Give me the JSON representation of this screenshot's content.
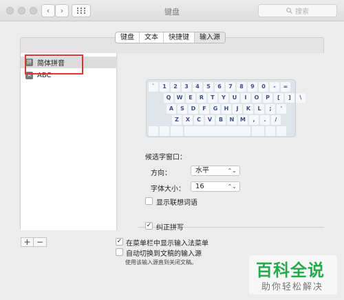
{
  "window": {
    "title": "键盘"
  },
  "toolbar": {
    "back_glyph": "‹",
    "forward_glyph": "›",
    "search_placeholder": "搜索"
  },
  "tabs": [
    {
      "label": "键盘"
    },
    {
      "label": "文本"
    },
    {
      "label": "快捷键"
    },
    {
      "label": "输入源",
      "selected": true
    }
  ],
  "sources": [
    {
      "label": "简体拼音",
      "icon": "拼",
      "selected": true
    },
    {
      "label": "ABC",
      "icon": "A"
    }
  ],
  "keyboard": {
    "row1": [
      "`",
      "1",
      "2",
      "3",
      "4",
      "5",
      "6",
      "7",
      "8",
      "9",
      "0",
      "-",
      "="
    ],
    "row2": [
      "Q",
      "W",
      "E",
      "R",
      "T",
      "Y",
      "U",
      "I",
      "O",
      "P",
      "[",
      "]",
      "\\"
    ],
    "row3": [
      "A",
      "S",
      "D",
      "F",
      "G",
      "H",
      "J",
      "K",
      "L",
      ";",
      "'"
    ],
    "row4": [
      "Z",
      "X",
      "C",
      "V",
      "B",
      "N",
      "M",
      ",",
      ".",
      "/"
    ]
  },
  "candidate_window": {
    "heading": "候选字窗口：",
    "direction_label": "方向：",
    "direction_value": "水平",
    "fontsize_label": "字体大小：",
    "fontsize_value": "16"
  },
  "options": {
    "show_predictions": {
      "label": "显示联想词语",
      "checked": false
    },
    "autocorrect": {
      "label": "纠正拼写",
      "checked": true
    },
    "show_menu": {
      "label": "在菜单栏中显示输入法菜单",
      "checked": true
    },
    "auto_switch": {
      "label": "自动切换到文稿的输入源",
      "checked": false
    }
  },
  "footer_note": "使用该输入源直到关闭文稿。",
  "source_controls": {
    "add": "+",
    "remove": "−"
  },
  "check_glyph": "✓",
  "select_chevron": "⌃⌄",
  "watermark": {
    "top": "百科全说",
    "bottom": "助你轻松解决"
  }
}
